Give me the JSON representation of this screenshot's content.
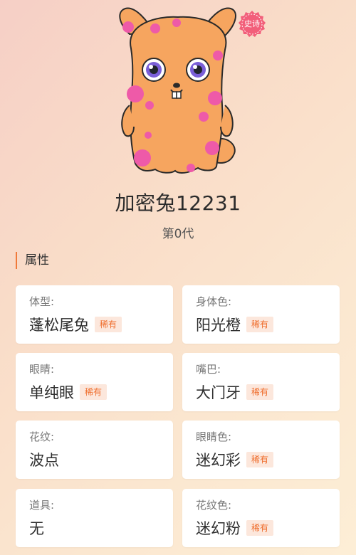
{
  "character": {
    "badge": "史诗",
    "name": "加密兔12231",
    "generation": "第0代"
  },
  "section": {
    "title": "属性"
  },
  "attributes": [
    {
      "label": "体型:",
      "value": "蓬松尾兔",
      "tag": "稀有"
    },
    {
      "label": "身体色:",
      "value": "阳光橙",
      "tag": "稀有"
    },
    {
      "label": "眼睛:",
      "value": "单纯眼",
      "tag": "稀有"
    },
    {
      "label": "嘴巴:",
      "value": "大门牙",
      "tag": "稀有"
    },
    {
      "label": "花纹:",
      "value": "波点",
      "tag": ""
    },
    {
      "label": "眼睛色:",
      "value": "迷幻彩",
      "tag": "稀有"
    },
    {
      "label": "道具:",
      "value": "无",
      "tag": ""
    },
    {
      "label": "花纹色:",
      "value": "迷幻粉",
      "tag": "稀有"
    }
  ],
  "colors": {
    "body": "#f6a55f",
    "spots": "#ee5aa8",
    "accent": "#f07a3a",
    "tag_bg": "#fce7dc",
    "badge": "#f25f7a"
  },
  "icons": {
    "badge_shape": "scalloped-seal",
    "creature": "spotted-rabbit"
  }
}
